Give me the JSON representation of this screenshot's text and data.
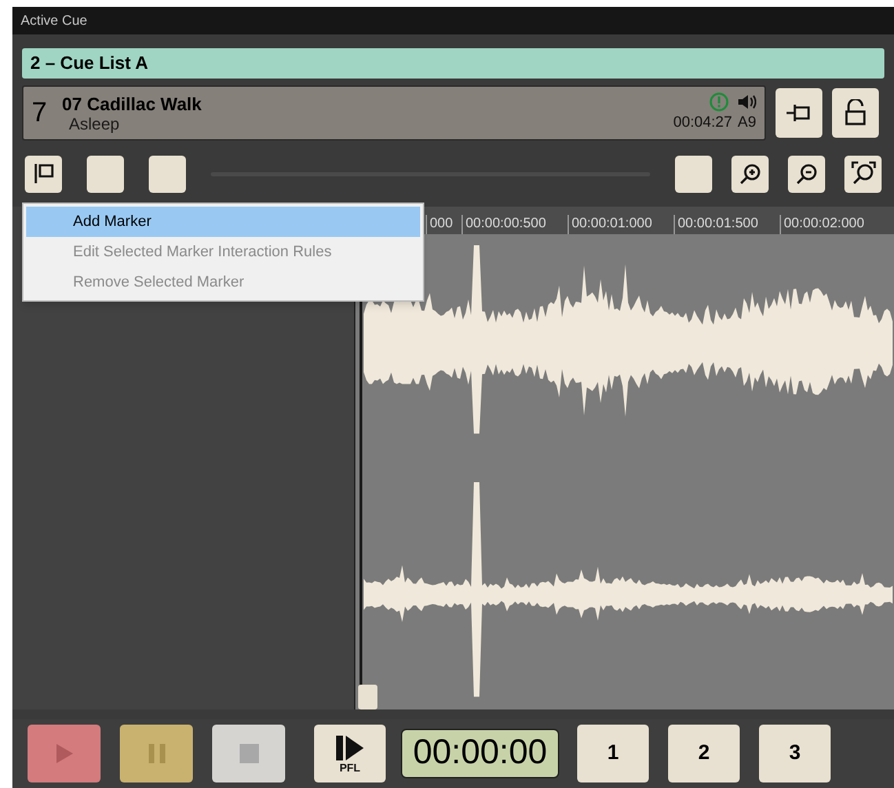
{
  "window": {
    "title": "Active Cue"
  },
  "cue_list": {
    "label": "2 – Cue List A"
  },
  "cue": {
    "number": "7",
    "name": "07 Cadillac Walk",
    "state": "Asleep",
    "duration": "00:04:27",
    "output": "A9",
    "warning": true
  },
  "context_menu": {
    "items": [
      {
        "label": "Add Marker",
        "selected": true,
        "disabled": false
      },
      {
        "label": "Edit Selected Marker Interaction Rules",
        "selected": false,
        "disabled": true
      },
      {
        "label": "Remove Selected Marker",
        "selected": false,
        "disabled": true
      }
    ]
  },
  "ruler": {
    "labels": [
      "000",
      "00:00:00:500",
      "00:00:01:000",
      "00:00:01:500",
      "00:00:02:000"
    ]
  },
  "transport": {
    "buttons": [
      {
        "kind": "play"
      },
      {
        "kind": "pause"
      },
      {
        "kind": "stop"
      }
    ],
    "pfl": "PFL",
    "timer": "00:00:00",
    "hotkeys": [
      "1",
      "2",
      "3"
    ]
  }
}
